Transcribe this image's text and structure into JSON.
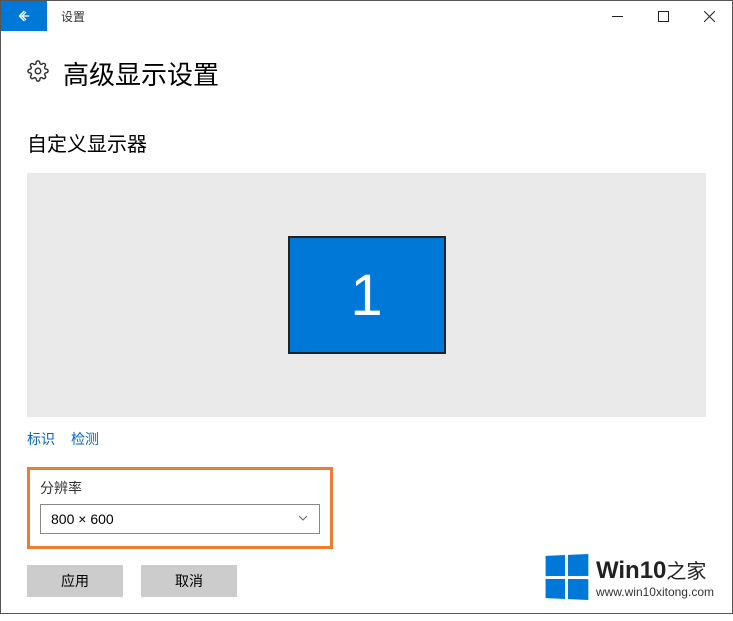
{
  "titlebar": {
    "app_name": "设置"
  },
  "page": {
    "title": "高级显示设置"
  },
  "section": {
    "custom_display": "自定义显示器"
  },
  "monitor": {
    "number": "1"
  },
  "links": {
    "identify": "标识",
    "detect": "检测"
  },
  "resolution": {
    "label": "分辨率",
    "value": "800 × 600"
  },
  "buttons": {
    "apply": "应用",
    "cancel": "取消"
  },
  "watermark": {
    "brand_en": "Win10",
    "brand_zh": "之家",
    "url": "www.win10xitong.com"
  }
}
